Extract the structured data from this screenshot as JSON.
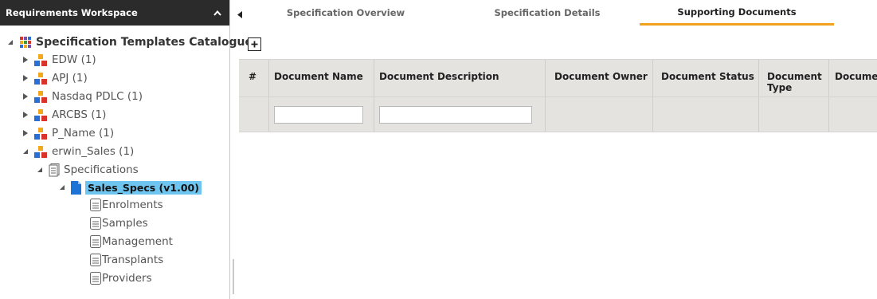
{
  "workspace": {
    "title": "Requirements Workspace"
  },
  "tree": {
    "root": "Specification Templates Catalogue",
    "nodes": [
      {
        "label": "EDW (1)"
      },
      {
        "label": "APJ (1)"
      },
      {
        "label": "Nasdaq PDLC (1)"
      },
      {
        "label": "ARCBS (1)"
      },
      {
        "label": "P_Name (1)"
      },
      {
        "label": "erwin_Sales (1)"
      }
    ],
    "folder": "Specifications",
    "selected": "Sales_Specs (v1.00)",
    "documents": [
      {
        "label": "Enrolments"
      },
      {
        "label": "Samples"
      },
      {
        "label": "Management"
      },
      {
        "label": "Transplants"
      },
      {
        "label": "Providers"
      }
    ]
  },
  "tabs": [
    {
      "label": "Specification Overview"
    },
    {
      "label": "Specification Details"
    },
    {
      "label": "Supporting Documents",
      "active": true
    }
  ],
  "grid": {
    "columns": [
      {
        "label": "#"
      },
      {
        "label": "Document Name"
      },
      {
        "label": "Document Description"
      },
      {
        "label": "Document Owner"
      },
      {
        "label": "Document Status"
      },
      {
        "label": "Document Type"
      },
      {
        "label": "Docume"
      }
    ],
    "filters": {
      "document_name": "",
      "document_description": ""
    }
  },
  "colors": {
    "header_bg": "#2b2b2b",
    "active_tab_underline": "#f0a21e",
    "selected_bg": "#6ec6f0",
    "grid_bg": "#e5e3e0"
  }
}
